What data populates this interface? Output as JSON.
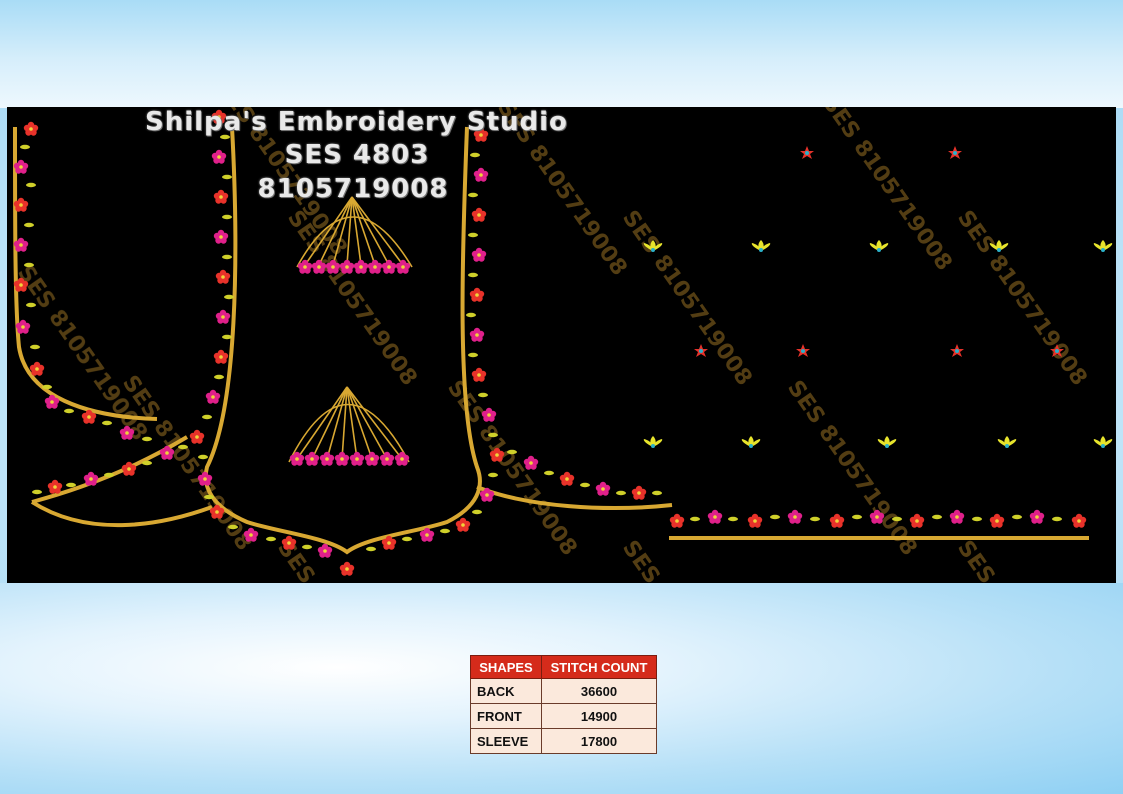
{
  "design": {
    "studio_name": "Shilpa's Embroidery Studio",
    "code": "SES  4803",
    "phone": "8105719008",
    "watermark": "SES 8105719008"
  },
  "colors": {
    "background_panel": "#000000",
    "border_gold": "#d8a832",
    "flower_red": "#e8322a",
    "flower_pink": "#e0208a",
    "leaf_yellow": "#d8d62a",
    "table_header": "#d52b1b",
    "table_cell": "#fbe9dc"
  },
  "table": {
    "headers": [
      "SHAPES",
      "STITCH COUNT"
    ],
    "rows": [
      {
        "shape": "BACK",
        "count": "36600"
      },
      {
        "shape": "FRONT",
        "count": "14900"
      },
      {
        "shape": "SLEEVE",
        "count": "17800"
      }
    ]
  }
}
